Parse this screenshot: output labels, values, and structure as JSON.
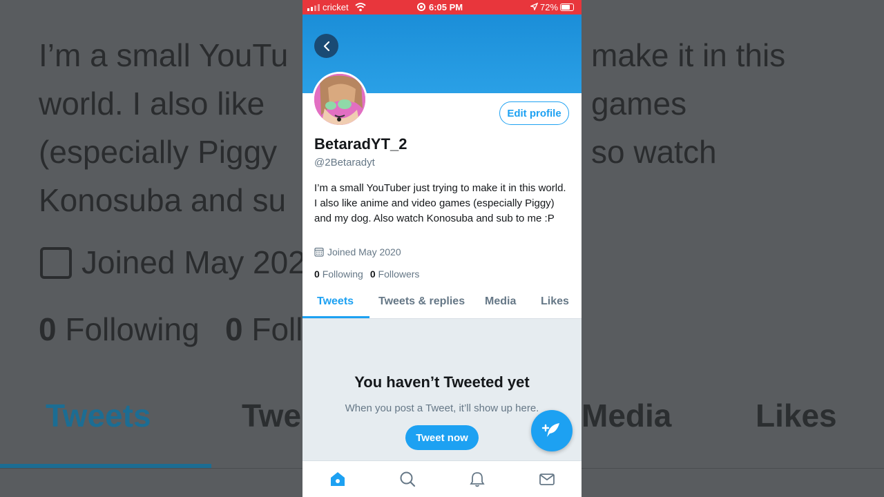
{
  "background": {
    "bio_lines": [
      "I’m a small YouTu",
      "world. I also like",
      "(especially Piggy",
      "Konosuba and su"
    ],
    "bio_lines_right": [
      "make it in this",
      "games",
      "so watch"
    ],
    "joined": "Joined May 202",
    "following_count": "0",
    "following_label": "Following",
    "followers_count": "0",
    "followers_label": "Foll",
    "tabs": [
      "Tweets",
      "Twe",
      "Media",
      "Likes"
    ]
  },
  "status_bar": {
    "carrier": "cricket",
    "time": "6:05 PM",
    "battery": "72%",
    "color": "#e8363c"
  },
  "profile": {
    "edit_label": "Edit profile",
    "name": "BetaradYT_2",
    "handle": "@2Betaradyt",
    "bio": "I’m a small YouTuber just trying to make it in this world. I also like anime and video games (especially Piggy) and my dog. Also watch Konosuba and sub to me :P",
    "joined": "Joined May 2020",
    "following_count": "0",
    "following_label": "Following",
    "followers_count": "0",
    "followers_label": "Followers"
  },
  "tabs": [
    {
      "label": "Tweets",
      "active": true
    },
    {
      "label": "Tweets & replies",
      "active": false
    },
    {
      "label": "Media",
      "active": false
    },
    {
      "label": "Likes",
      "active": false
    }
  ],
  "empty_state": {
    "title": "You haven’t Tweeted yet",
    "subtitle": "When you post a Tweet, it’ll show up here.",
    "button": "Tweet now"
  },
  "bottom_nav": [
    "home-icon",
    "search-icon",
    "notifications-icon",
    "messages-icon"
  ],
  "accent": "#1da1f2"
}
